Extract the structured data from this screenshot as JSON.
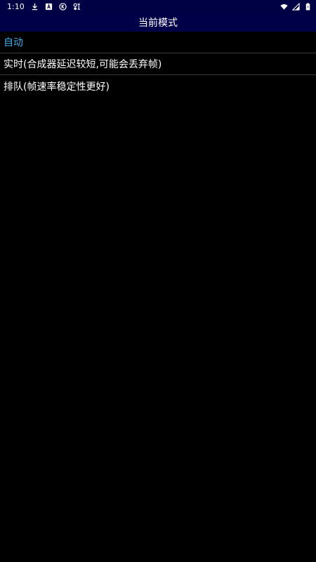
{
  "status_bar": {
    "time": "1:10",
    "icons": [
      "download-icon",
      "notification-a-icon",
      "k-icon",
      "network-tools-icon",
      "wifi-icon",
      "signal-icon",
      "battery-icon"
    ]
  },
  "header": {
    "title": "当前模式"
  },
  "modes": [
    {
      "label": "自动",
      "selected": true
    },
    {
      "label": "实时(合成器延迟较短,可能会丢弃帧)",
      "selected": false
    },
    {
      "label": "排队(帧速率稳定性更好)",
      "selected": false
    }
  ],
  "colors": {
    "status_bar_bg": "#000044",
    "header_bg": "#000048",
    "background": "#000000",
    "selected_text": "#3fa9e8",
    "divider": "#3a3a3a"
  }
}
